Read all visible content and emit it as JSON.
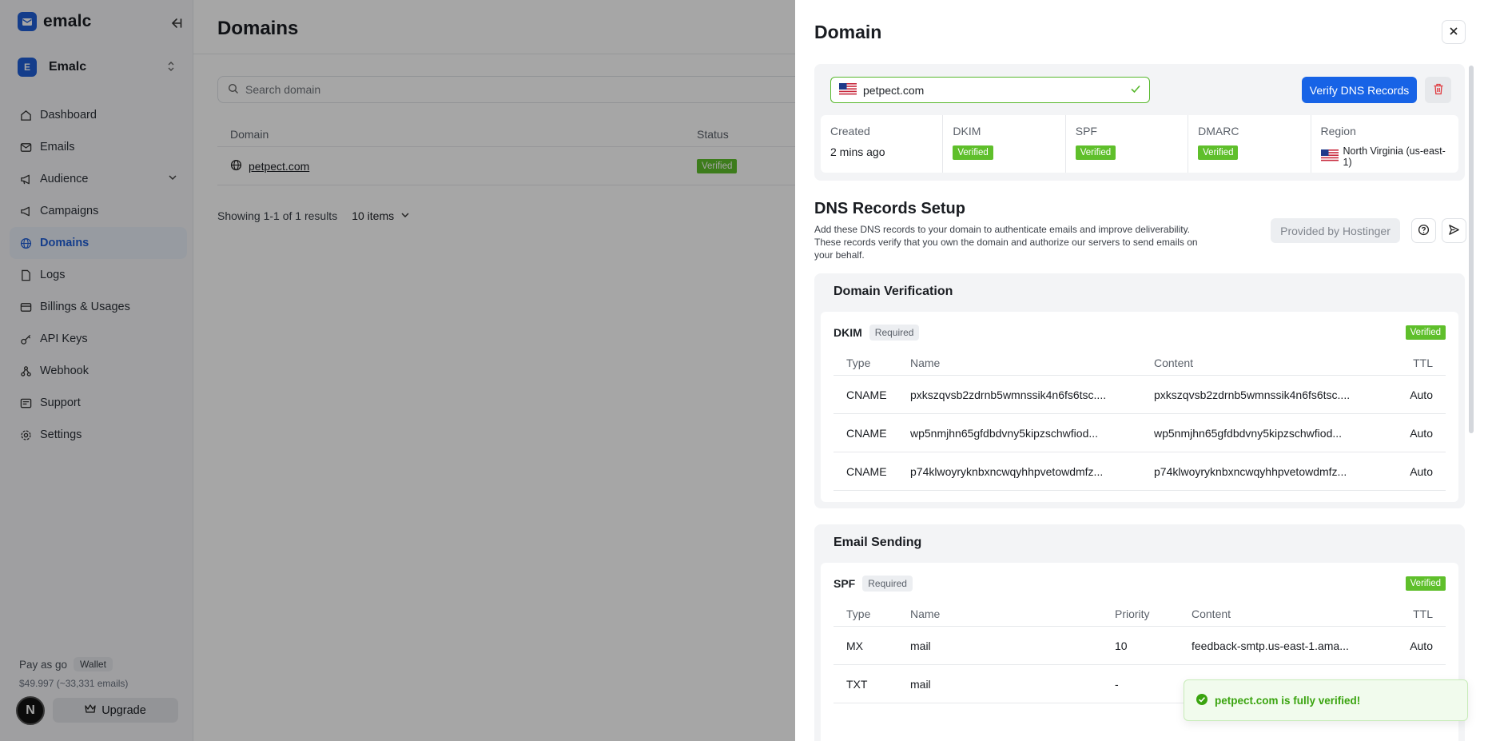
{
  "brand": {
    "name": "emalc"
  },
  "workspace": {
    "initial": "E",
    "name": "Emalc"
  },
  "sidebar": {
    "items": [
      {
        "label": "Dashboard"
      },
      {
        "label": "Emails"
      },
      {
        "label": "Audience"
      },
      {
        "label": "Campaigns"
      },
      {
        "label": "Domains"
      },
      {
        "label": "Logs"
      },
      {
        "label": "Billings & Usages"
      },
      {
        "label": "API Keys"
      },
      {
        "label": "Webhook"
      },
      {
        "label": "Support"
      },
      {
        "label": "Settings"
      }
    ],
    "plan": {
      "name": "Pay as go",
      "wallet_label": "Wallet",
      "balance": "$49.997 (~33,331 emails)"
    },
    "user_initial": "N",
    "upgrade_label": "Upgrade"
  },
  "main": {
    "title": "Domains",
    "search_placeholder": "Search domain",
    "table": {
      "headers": {
        "domain": "Domain",
        "status": "Status"
      },
      "rows": [
        {
          "domain": "petpect.com",
          "status": "Verified"
        }
      ]
    },
    "pagination": {
      "summary": "Showing 1-1 of 1 results",
      "per_page": "10 items"
    }
  },
  "drawer": {
    "title": "Domain",
    "domain_value": "petpect.com",
    "verify_label": "Verify DNS Records",
    "stats": {
      "created_label": "Created",
      "created_value": "2 mins ago",
      "dkim_label": "DKIM",
      "dkim_value": "Verified",
      "spf_label": "SPF",
      "spf_value": "Verified",
      "dmarc_label": "DMARC",
      "dmarc_value": "Verified",
      "region_label": "Region",
      "region_value": "North Virginia (us-east-1)"
    },
    "dns": {
      "title": "DNS Records Setup",
      "description": "Add these DNS records to your domain to authenticate emails and improve deliverability. These records verify that you own the domain and authorize our servers to send emails on your behalf.",
      "provider": "Provided by Hostinger"
    },
    "verification": {
      "title": "Domain Verification",
      "record_name": "DKIM",
      "required_label": "Required",
      "status": "Verified",
      "headers": {
        "type": "Type",
        "name": "Name",
        "content": "Content",
        "ttl": "TTL"
      },
      "rows": [
        {
          "type": "CNAME",
          "name": "pxkszqvsb2zdrnb5wmnssik4n6fs6tsc....",
          "content": "pxkszqvsb2zdrnb5wmnssik4n6fs6tsc....",
          "ttl": "Auto"
        },
        {
          "type": "CNAME",
          "name": "wp5nmjhn65gfdbdvny5kipzschwfiod...",
          "content": "wp5nmjhn65gfdbdvny5kipzschwfiod...",
          "ttl": "Auto"
        },
        {
          "type": "CNAME",
          "name": "p74klwoyryknbxncwqyhhpvetowdmfz...",
          "content": "p74klwoyryknbxncwqyhhpvetowdmfz...",
          "ttl": "Auto"
        }
      ]
    },
    "sending": {
      "title": "Email Sending",
      "record_name": "SPF",
      "required_label": "Required",
      "status": "Verified",
      "headers": {
        "type": "Type",
        "name": "Name",
        "priority": "Priority",
        "content": "Content",
        "ttl": "TTL"
      },
      "rows": [
        {
          "type": "MX",
          "name": "mail",
          "priority": "10",
          "content": "feedback-smtp.us-east-1.ama...",
          "ttl": "Auto"
        },
        {
          "type": "TXT",
          "name": "mail",
          "priority": "-",
          "content": "",
          "ttl": ""
        }
      ]
    }
  },
  "toast": {
    "message": "petpect.com is fully verified!"
  },
  "colors": {
    "accent": "#1763e6",
    "verified": "#5fbf2b",
    "toast_text": "#3aa40f"
  }
}
